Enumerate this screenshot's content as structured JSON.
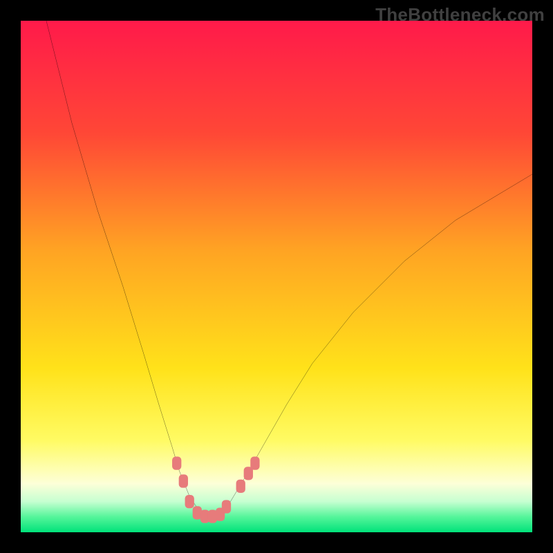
{
  "watermark": "TheBottleneck.com",
  "chart_data": {
    "type": "line",
    "title": "",
    "xlabel": "",
    "ylabel": "",
    "xlim": [
      0,
      100
    ],
    "ylim": [
      0,
      100
    ],
    "curve": {
      "name": "bottleneck-curve",
      "x": [
        5,
        10,
        15,
        20,
        24,
        27,
        29.5,
        31,
        33,
        35,
        36,
        37,
        39,
        41,
        44,
        48,
        52,
        57,
        65,
        75,
        85,
        95,
        100
      ],
      "y": [
        100,
        80,
        63,
        48,
        35,
        25,
        17,
        12,
        7,
        4,
        3,
        3,
        3,
        6,
        11,
        18,
        25,
        33,
        43,
        53,
        61,
        67,
        70
      ]
    },
    "ideal_band": {
      "ymin": 0,
      "ymax": 3
    },
    "markers": {
      "name": "sample-points",
      "color": "#e77b7b",
      "points": [
        {
          "x": 30.5,
          "y": 13.5
        },
        {
          "x": 31.8,
          "y": 10.0
        },
        {
          "x": 33.0,
          "y": 6.0
        },
        {
          "x": 34.5,
          "y": 3.8
        },
        {
          "x": 36.0,
          "y": 3.1
        },
        {
          "x": 37.5,
          "y": 3.1
        },
        {
          "x": 39.0,
          "y": 3.5
        },
        {
          "x": 40.2,
          "y": 5.0
        },
        {
          "x": 43.0,
          "y": 9.0
        },
        {
          "x": 44.5,
          "y": 11.5
        },
        {
          "x": 45.8,
          "y": 13.5
        }
      ]
    },
    "background_gradient": {
      "stops": [
        {
          "pos": 0.0,
          "color": "#ff1a4a"
        },
        {
          "pos": 0.22,
          "color": "#ff4736"
        },
        {
          "pos": 0.45,
          "color": "#ffa423"
        },
        {
          "pos": 0.68,
          "color": "#ffe21a"
        },
        {
          "pos": 0.82,
          "color": "#fffb63"
        },
        {
          "pos": 0.905,
          "color": "#fdffd8"
        },
        {
          "pos": 0.94,
          "color": "#c6ffd1"
        },
        {
          "pos": 0.97,
          "color": "#55f59a"
        },
        {
          "pos": 1.0,
          "color": "#00e27a"
        }
      ]
    }
  }
}
